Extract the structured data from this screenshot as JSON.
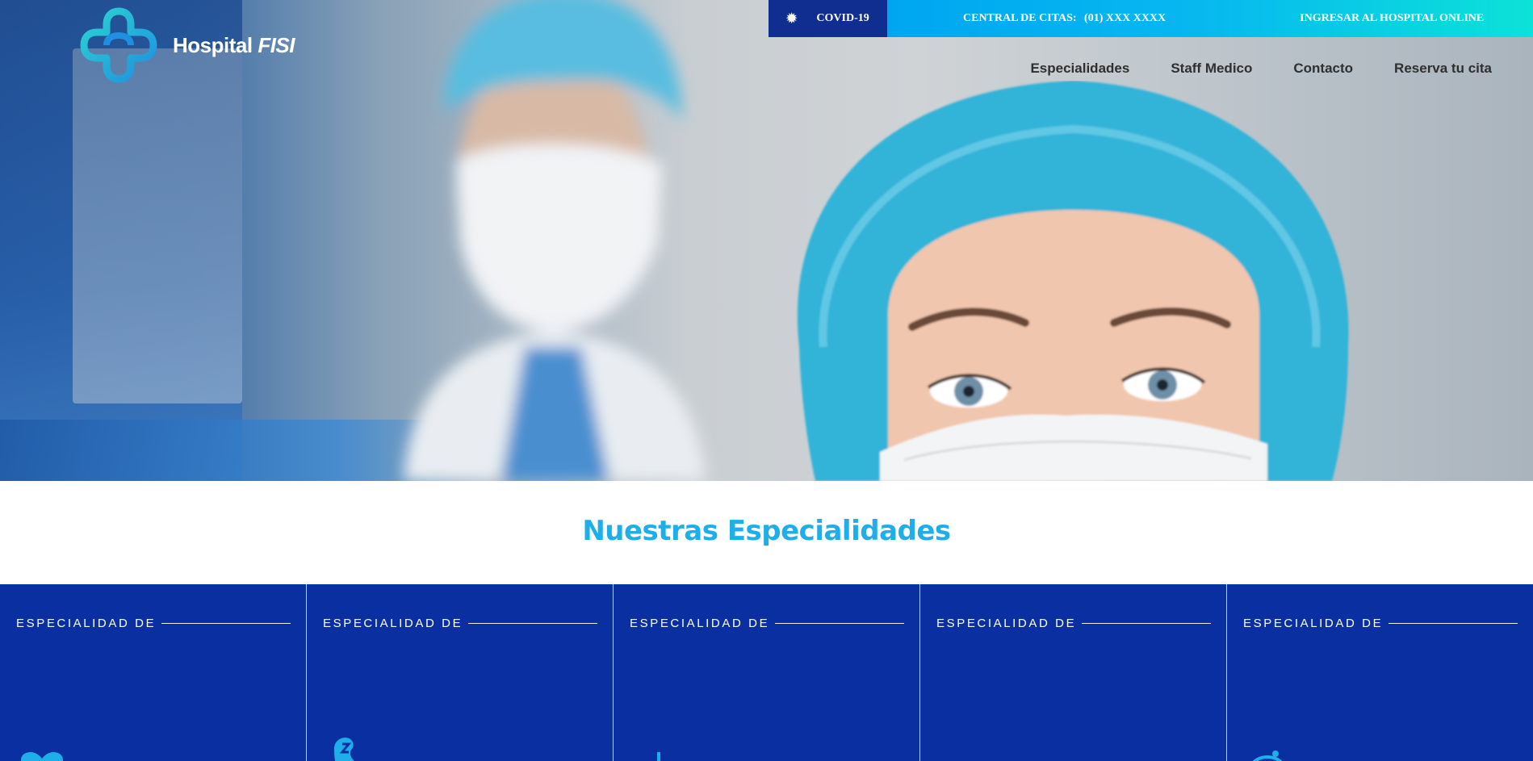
{
  "brand": {
    "name": "Hospital",
    "name_italic": "FISI"
  },
  "topbar": {
    "covid_label": "COVID-19",
    "citas_label": "CENTRAL DE CITAS:",
    "citas_number": "(01) XXX XXXX",
    "online_label": "INGRESAR AL HOSPITAL ONLINE"
  },
  "nav": {
    "items": [
      "Especialidades",
      "Staff Medico",
      "Contacto",
      "Reserva tu cita"
    ]
  },
  "section": {
    "title": "Nuestras Especialidades"
  },
  "cards": [
    {
      "label": "ESPECIALIDAD DE",
      "icon": "heart-icon"
    },
    {
      "label": "ESPECIALIDAD DE",
      "icon": "kidney-icon"
    },
    {
      "label": "ESPECIALIDAD DE",
      "icon": "foot-icon"
    },
    {
      "label": "ESPECIALIDAD DE",
      "icon": "medical-icon"
    },
    {
      "label": "ESPECIALIDAD DE",
      "icon": "stethoscope-icon"
    }
  ],
  "colors": {
    "accent": "#1eaee9",
    "navy": "#0a2fa0",
    "covid_bg": "#0f2e8f",
    "topbar_gradient_start": "#00a6f1",
    "topbar_gradient_end": "#0ce2d8",
    "nav_text": "#2f2f2f"
  }
}
